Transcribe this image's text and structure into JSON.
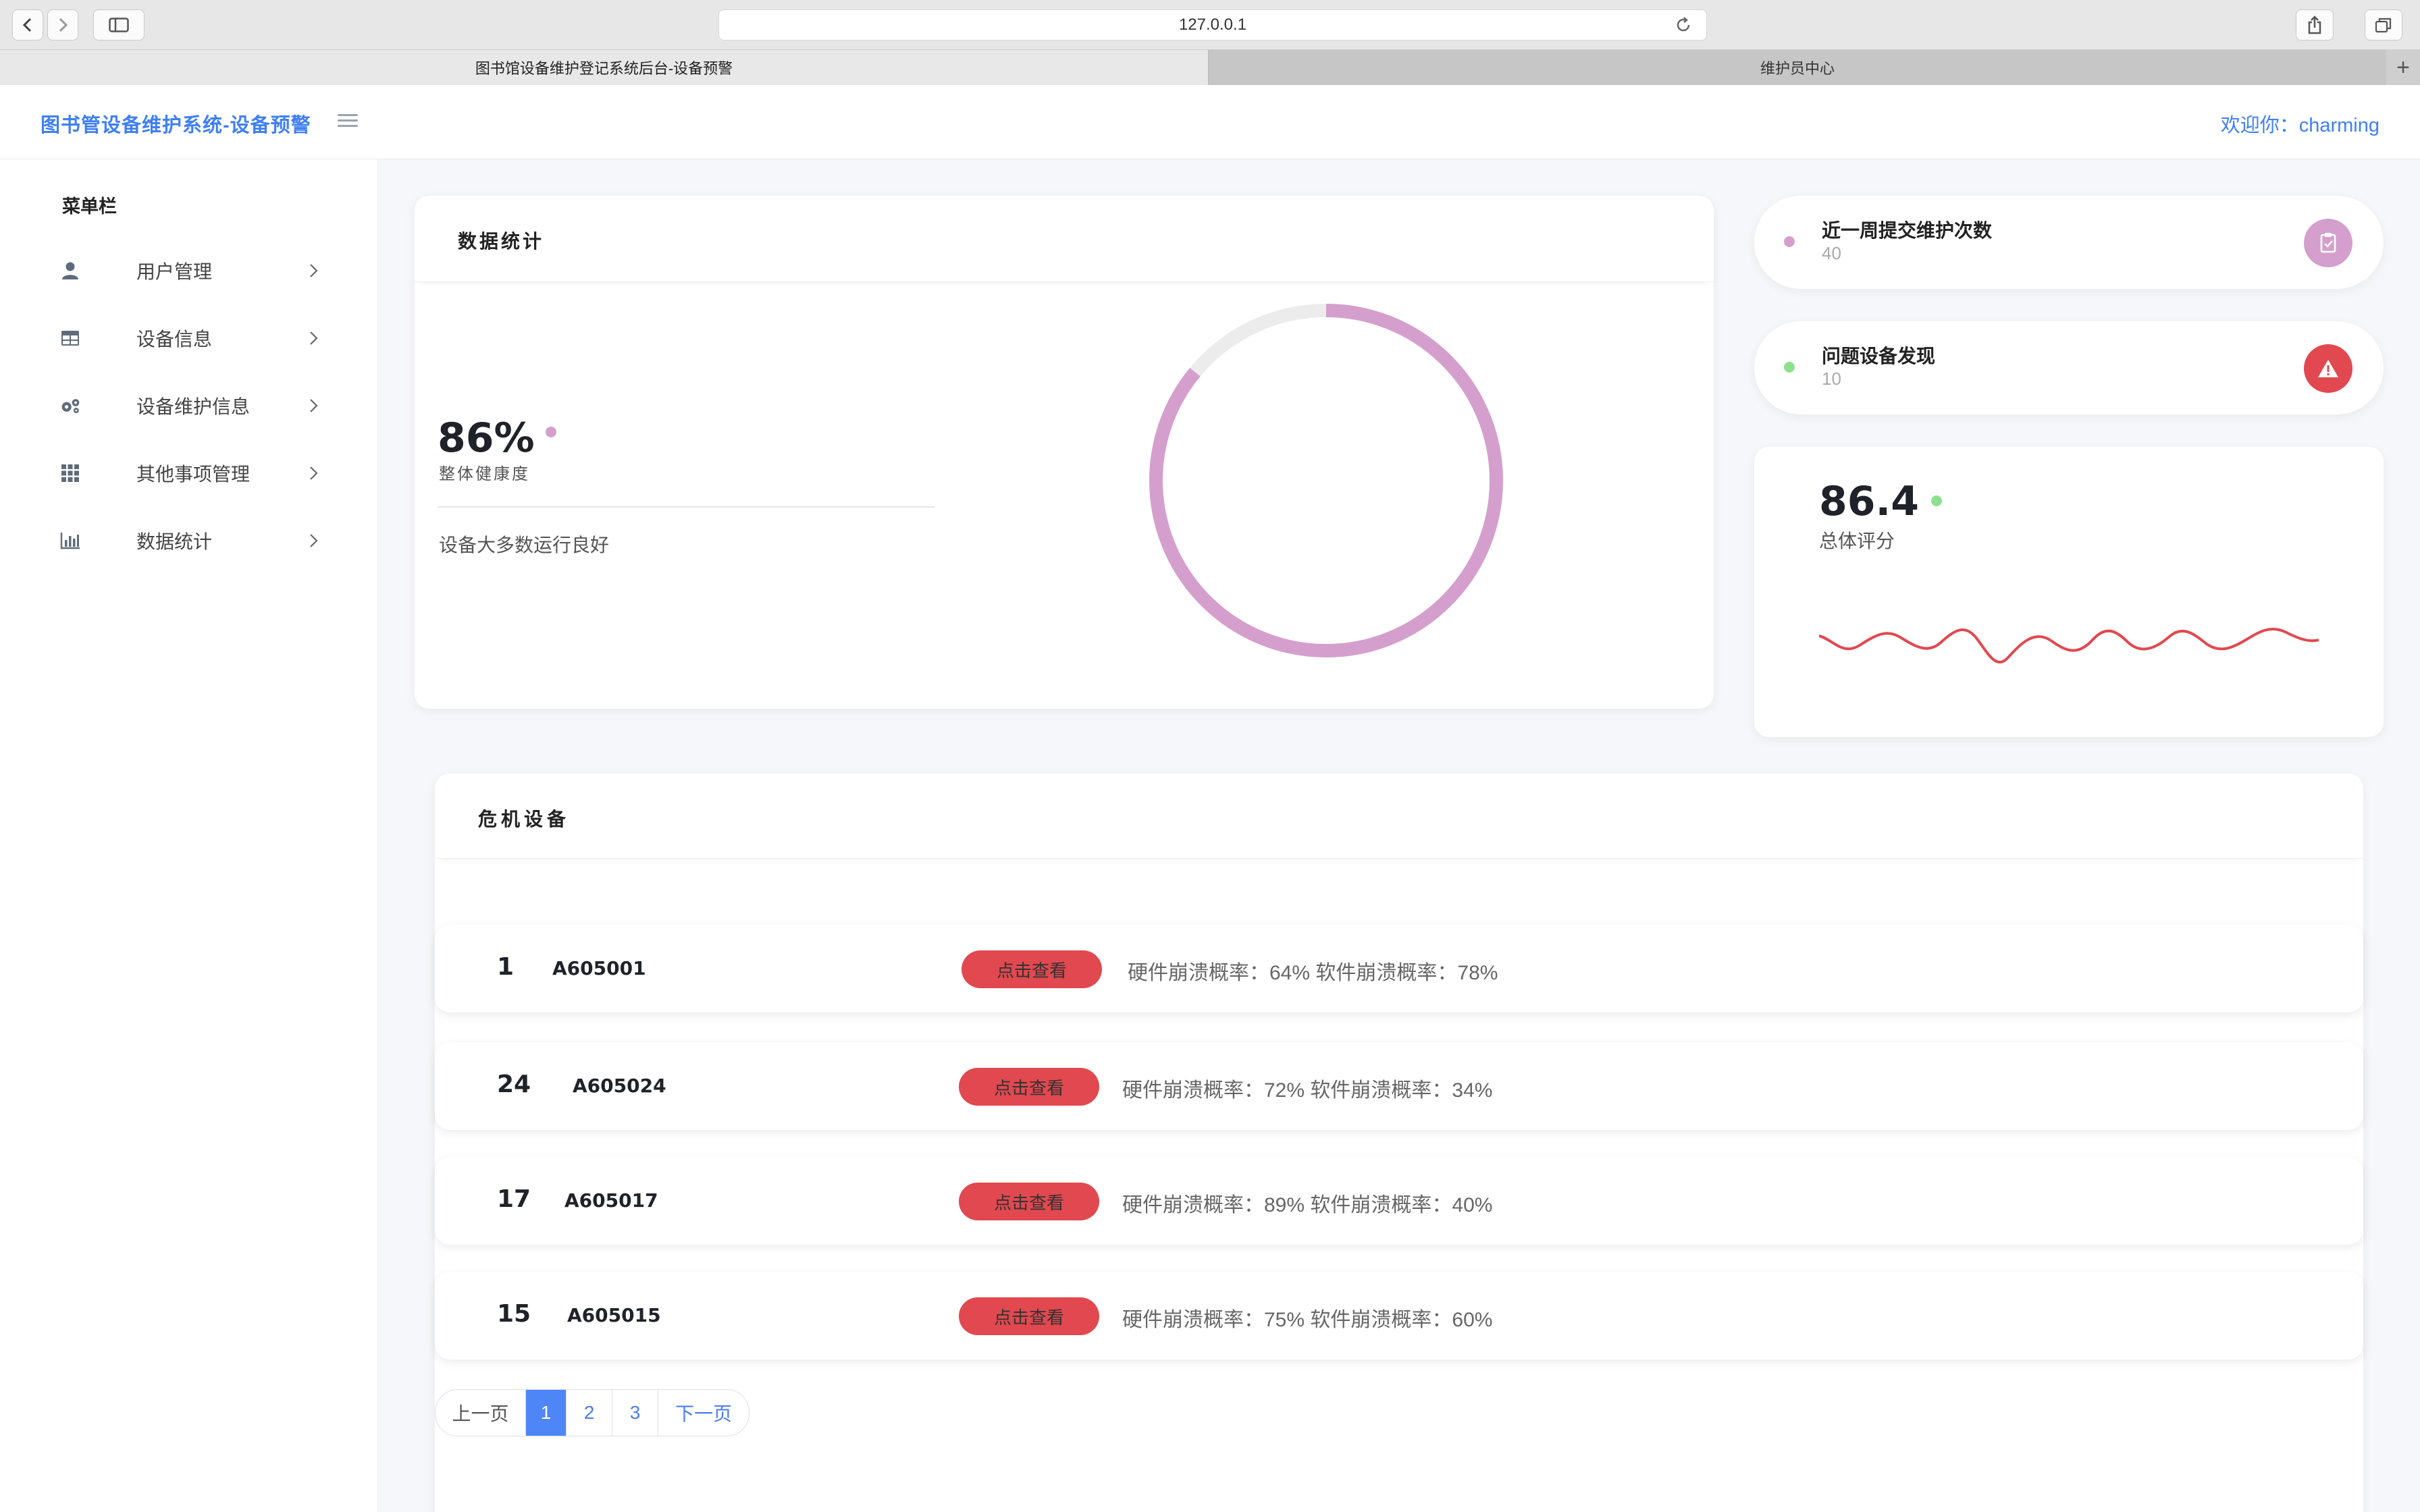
{
  "browser": {
    "url": "127.0.0.1",
    "tabs": [
      {
        "label": "图书馆设备维护登记系统后台-设备预警"
      },
      {
        "label": "维护员中心"
      }
    ],
    "new_tab": "+"
  },
  "header": {
    "title": "图书管设备维护系统-设备预警",
    "welcome": "欢迎你：charming"
  },
  "sidebar": {
    "title": "菜单栏",
    "items": [
      {
        "label": "用户管理",
        "icon": "user-icon"
      },
      {
        "label": "设备信息",
        "icon": "table-icon"
      },
      {
        "label": "设备维护信息",
        "icon": "gears-icon"
      },
      {
        "label": "其他事项管理",
        "icon": "grid-icon"
      },
      {
        "label": "数据统计",
        "icon": "bar-chart-icon"
      }
    ]
  },
  "stats": {
    "title": "数据统计",
    "percent": "86%",
    "percent_value": 0.86,
    "subtitle": "整体健康度",
    "description": "设备大多数运行良好",
    "accent": "#d59fcd",
    "track": "#ececec"
  },
  "mini_cards": [
    {
      "title": "近一周提交维护次数",
      "value": "40",
      "dot_color": "#d59fcd",
      "icon_color": "#d59fcd",
      "icon": "clipboard-check-icon"
    },
    {
      "title": "问题设备发现",
      "value": "10",
      "dot_color": "#8ee08e",
      "icon_color": "#e2484f",
      "icon": "warning-icon"
    }
  ],
  "score": {
    "value": "86.4",
    "label": "总体评分",
    "dot_color": "#8ee08e",
    "wave_color": "#e2484f"
  },
  "crisis": {
    "title": "危机设备",
    "button_label": "点击查看",
    "rows": [
      {
        "num": "1",
        "id": "A605001",
        "info": "硬件崩溃概率：64%   软件崩溃概率：78%"
      },
      {
        "num": "24",
        "id": "A605024",
        "info": "硬件崩溃概率：72%   软件崩溃概率：34%"
      },
      {
        "num": "17",
        "id": "A605017",
        "info": "硬件崩溃概率：89%   软件崩溃概率：40%"
      },
      {
        "num": "15",
        "id": "A605015",
        "info": "硬件崩溃概率：75%   软件崩溃概率：60%"
      }
    ]
  },
  "pagination": {
    "prev": "上一页",
    "pages": [
      "1",
      "2",
      "3"
    ],
    "current": "1",
    "next": "下一页"
  }
}
